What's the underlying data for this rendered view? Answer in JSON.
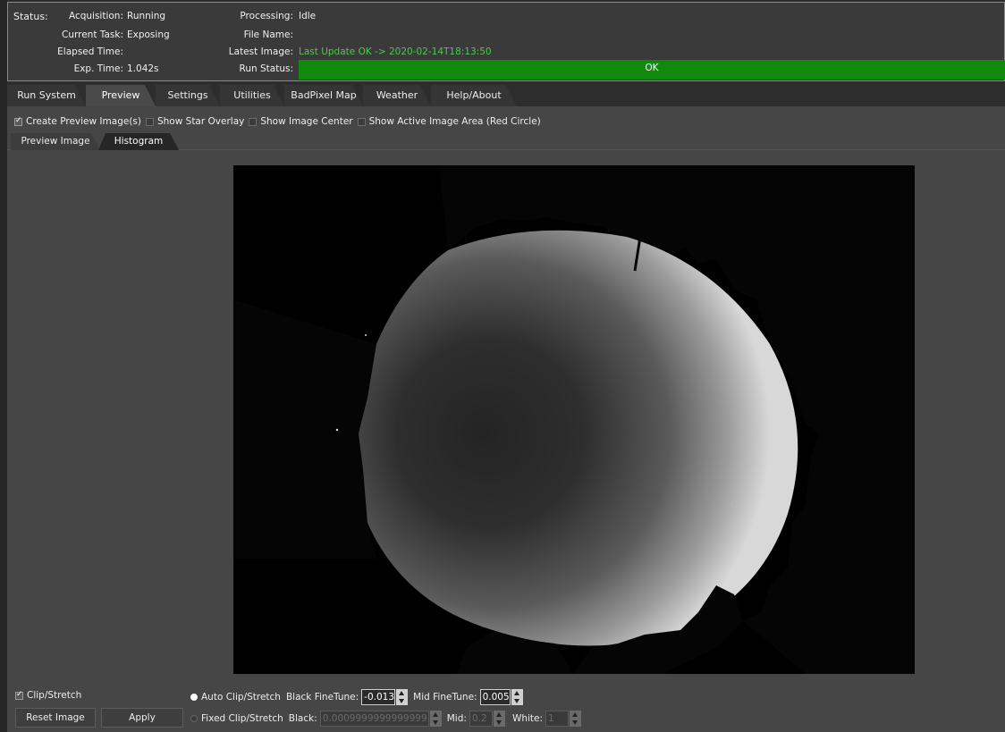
{
  "status": {
    "title": "Status:",
    "acquisition_label": "Acquisition:",
    "acquisition_value": "Running",
    "current_task_label": "Current Task:",
    "current_task_value": "Exposing",
    "elapsed_time_label": "Elapsed Time:",
    "elapsed_time_value": "",
    "exp_time_label": "Exp. Time:",
    "exp_time_value": "1.042s",
    "processing_label": "Processing:",
    "processing_value": "Idle",
    "file_name_label": "File Name:",
    "file_name_value": "",
    "latest_image_label": "Latest Image:",
    "latest_image_value": "Last Update OK -> 2020-02-14T18:13:50",
    "run_status_label": "Run Status:",
    "run_status_value": "OK",
    "run_status_color": "#0f8a0f"
  },
  "tabs": [
    {
      "label": "Run System"
    },
    {
      "label": "Preview"
    },
    {
      "label": "Settings"
    },
    {
      "label": "Utilities"
    },
    {
      "label": "BadPixel Map"
    },
    {
      "label": "Weather"
    },
    {
      "label": "Help/About"
    }
  ],
  "active_tab": "Preview",
  "preview_options": {
    "create_preview": {
      "label": "Create Preview Image(s)",
      "checked": true
    },
    "star_overlay": {
      "label": "Show Star Overlay",
      "checked": false
    },
    "image_center": {
      "label": "Show Image Center",
      "checked": false
    },
    "active_area": {
      "label": "Show Active Image Area (Red Circle)",
      "checked": false
    }
  },
  "subtabs": [
    {
      "label": "Preview Image"
    },
    {
      "label": "Histogram"
    }
  ],
  "active_subtab": "Histogram",
  "controls": {
    "clip_stretch": {
      "label": "Clip/Stretch",
      "checked": true
    },
    "reset_label": "Reset Image",
    "apply_label": "Apply",
    "auto_clip": {
      "label": "Auto Clip/Stretch",
      "selected": true
    },
    "black_finetune_label": "Black FineTune:",
    "black_finetune_value": "-0.013",
    "mid_finetune_label": "Mid FineTune:",
    "mid_finetune_value": "0.005",
    "fixed_clip": {
      "label": "Fixed Clip/Stretch",
      "selected": false
    },
    "black_label": "Black:",
    "black_value": "0.0009999999999999",
    "mid_label": "Mid:",
    "mid_value": "0.2",
    "white_label": "White:",
    "white_value": "1"
  }
}
